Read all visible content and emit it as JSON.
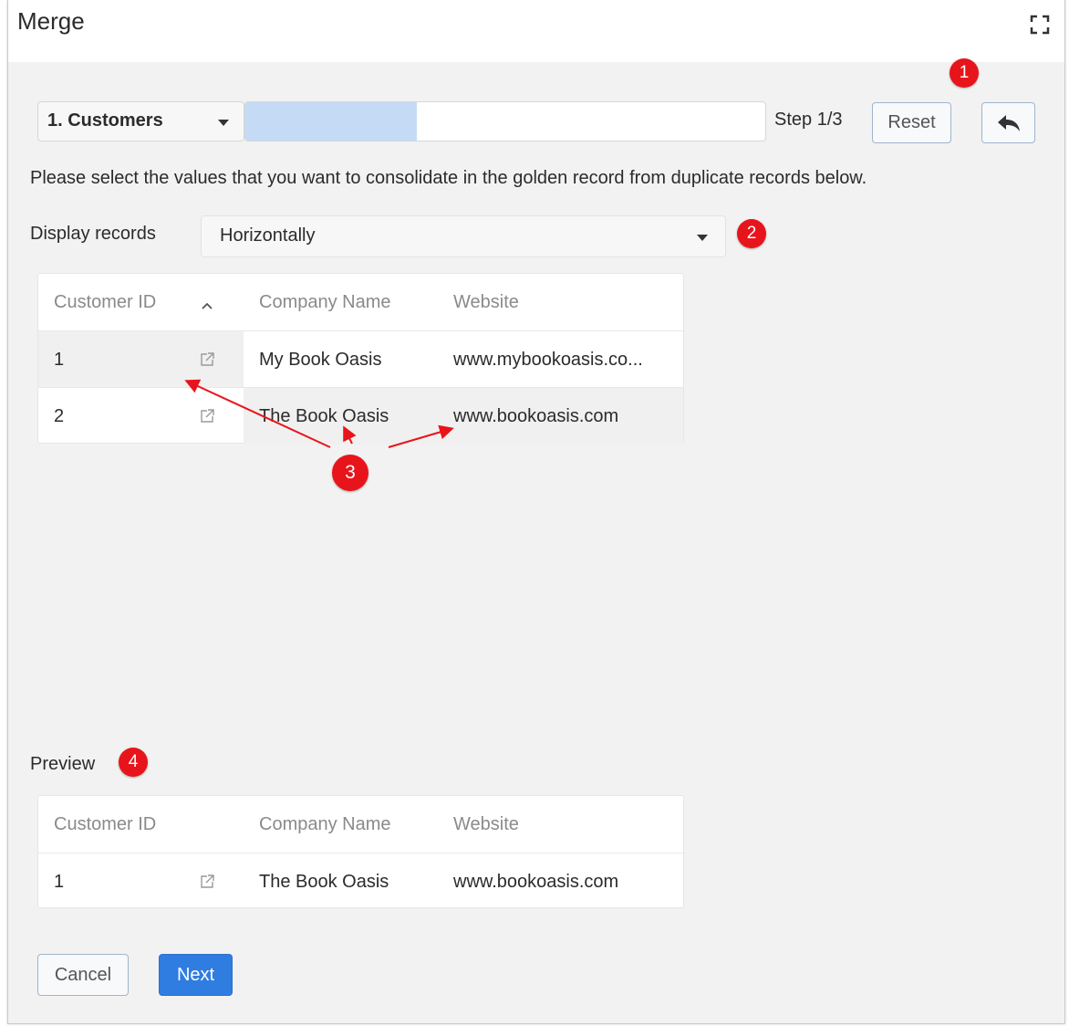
{
  "dialog": {
    "title": "Merge",
    "maximize_icon": "maximize-icon"
  },
  "toolbar": {
    "entity_select": "1. Customers",
    "progress_fraction": 0.33,
    "step_text": "Step 1/3",
    "reset_label": "Reset",
    "back_icon": "reply-arrow-icon"
  },
  "instructions": "Please select the values that you want to consolidate in the golden record from duplicate records below.",
  "display": {
    "label": "Display records",
    "value": "Horizontally"
  },
  "records": {
    "columns": [
      "Customer ID",
      "Company Name",
      "Website"
    ],
    "rows": [
      {
        "id": "1",
        "company": "My Book Oasis",
        "website": "www.mybookoasis.co..."
      },
      {
        "id": "2",
        "company": "The Book Oasis",
        "website": "www.bookoasis.com"
      }
    ]
  },
  "preview": {
    "label": "Preview",
    "columns": [
      "Customer ID",
      "Company Name",
      "Website"
    ],
    "rows": [
      {
        "id": "1",
        "company": "The Book Oasis",
        "website": "www.bookoasis.com"
      }
    ]
  },
  "footer": {
    "cancel_label": "Cancel",
    "next_label": "Next"
  },
  "markers": [
    "1",
    "2",
    "3",
    "4"
  ],
  "colors": {
    "accent": "#2f7de1",
    "marker": "#e8141b",
    "progress": "#c5dbf5"
  }
}
